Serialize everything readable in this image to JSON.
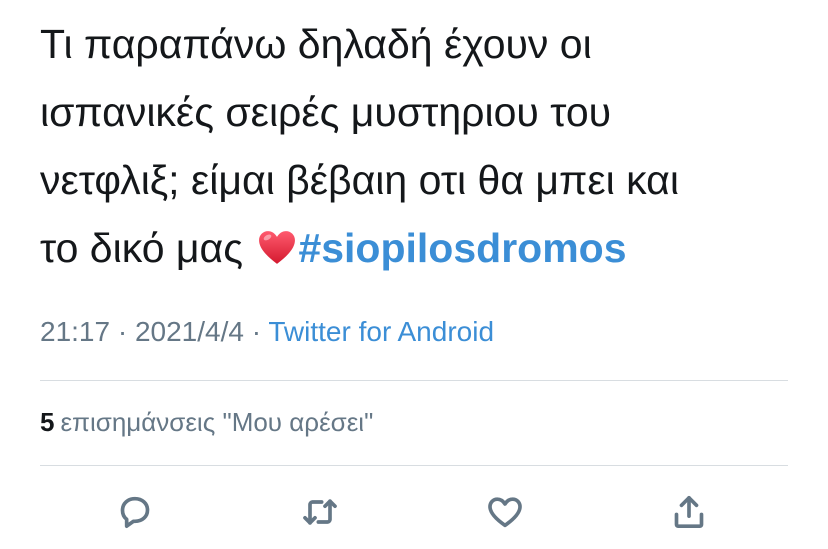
{
  "tweet": {
    "lines": [
      "Τι παραπάνω δηλαδή έχουν οι",
      "ισπανικές σειρές μυστηριου  του",
      "νετφλιξ; είμαι βέβαιη οτι θα μπει και",
      "το δικό μας"
    ],
    "emoji": "red-heart",
    "hashtag": "#siopilosdromos"
  },
  "meta": {
    "time": "21:17",
    "separator1": " · ",
    "date": "2021/4/4",
    "separator2": " · ",
    "source": "Twitter for Android"
  },
  "likes": {
    "count": "5",
    "label": "επισημάνσεις \"Μου αρέσει\""
  },
  "actions": {
    "reply_icon": "reply-icon",
    "retweet_icon": "retweet-icon",
    "like_icon": "heart-icon",
    "share_icon": "share-icon"
  },
  "colors": {
    "text": "#14171a",
    "link": "#3b8ed6",
    "muted": "#657786",
    "divider": "#d8dde1",
    "heart": "#e0243a"
  }
}
